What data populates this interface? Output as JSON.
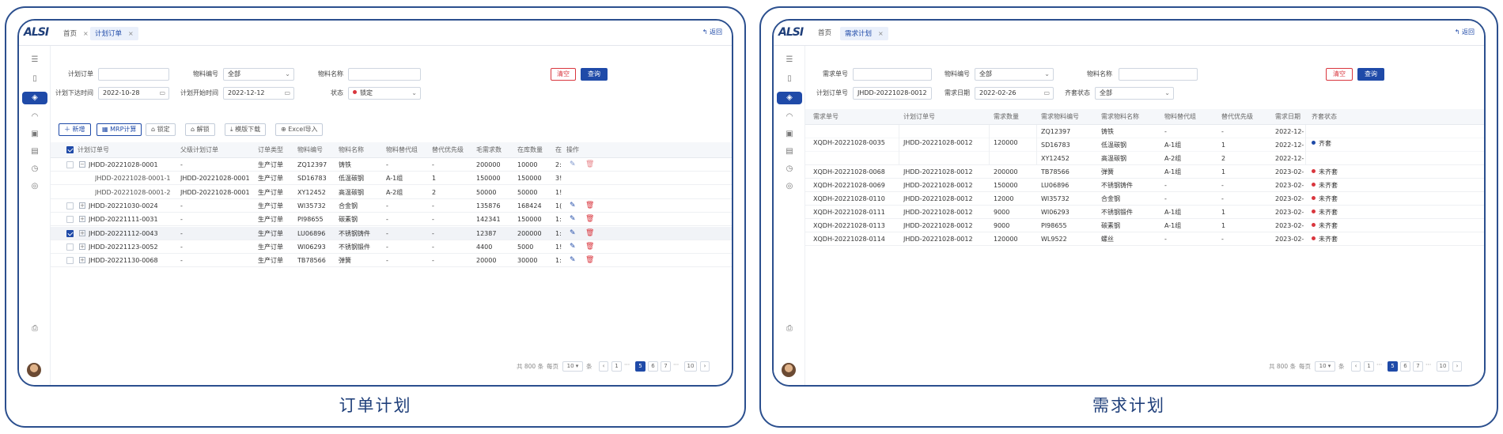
{
  "left": {
    "caption": "订单计划",
    "tabs": [
      {
        "label": "首页"
      },
      {
        "label": "计划订单"
      }
    ],
    "back_label": "返回",
    "filters": {
      "plan_order_label": "计划订单",
      "material_code_label": "物料编号",
      "material_code_value": "全部",
      "material_name_label": "物料名称",
      "issue_time_label": "计划下达时间",
      "issue_time_value": "2022-10-28",
      "start_time_label": "计划开始时间",
      "start_time_value": "2022-12-12",
      "status_label": "状态",
      "status_value": "锁定"
    },
    "clear_label": "清空",
    "query_label": "查询",
    "toolbar": [
      "新增",
      "MRP计算",
      "锁定",
      "解锁",
      "模版下载",
      "Excel导入"
    ],
    "columns": [
      "计划订单号",
      "父级计划订单",
      "订单类型",
      "物料编号",
      "物料名称",
      "物料替代组",
      "替代优先级",
      "毛需求数",
      "在库数量",
      "在",
      "操作"
    ],
    "rows": [
      {
        "no": "JHDD-20221028-0001",
        "parent": "-",
        "type": "生产订单",
        "code": "ZQ12397",
        "name": "铸铁",
        "group": "-",
        "prio": "-",
        "gross": "200000",
        "stock": "10000",
        "more": "2:"
      },
      {
        "no": "JHDD-20221028-0001-1",
        "parent": "JHDD-20221028-0001",
        "type": "生产订单",
        "code": "SD16783",
        "name": "低温碳钢",
        "group": "A-1组",
        "prio": "1",
        "gross": "150000",
        "stock": "150000",
        "more": "3!"
      },
      {
        "no": "JHDD-20221028-0001-2",
        "parent": "JHDD-20221028-0001",
        "type": "生产订单",
        "code": "XY12452",
        "name": "高温碳钢",
        "group": "A-2组",
        "prio": "2",
        "gross": "50000",
        "stock": "50000",
        "more": "1!"
      },
      {
        "no": "JHDD-20221030-0024",
        "parent": "-",
        "type": "生产订单",
        "code": "WI35732",
        "name": "合金钢",
        "group": "-",
        "prio": "-",
        "gross": "135876",
        "stock": "168424",
        "more": "1("
      },
      {
        "no": "JHDD-20221111-0031",
        "parent": "-",
        "type": "生产订单",
        "code": "PI98655",
        "name": "碳素钢",
        "group": "-",
        "prio": "-",
        "gross": "142341",
        "stock": "150000",
        "more": "1:"
      },
      {
        "no": "JHDD-20221112-0043",
        "parent": "-",
        "type": "生产订单",
        "code": "LU06896",
        "name": "不锈钢铸件",
        "group": "-",
        "prio": "-",
        "gross": "12387",
        "stock": "200000",
        "more": "1:"
      },
      {
        "no": "JHDD-20221123-0052",
        "parent": "-",
        "type": "生产订单",
        "code": "WI06293",
        "name": "不锈钢锻件",
        "group": "-",
        "prio": "-",
        "gross": "4400",
        "stock": "5000",
        "more": "1!"
      },
      {
        "no": "JHDD-20221130-0068",
        "parent": "-",
        "type": "生产订单",
        "code": "TB78566",
        "name": "弹簧",
        "group": "-",
        "prio": "-",
        "gross": "20000",
        "stock": "30000",
        "more": "1:"
      }
    ],
    "pager": {
      "total": "共 800 条",
      "per_page_label": "每页",
      "per_page": "10",
      "unit": "条",
      "pages": [
        "1",
        "5",
        "6",
        "7",
        "10"
      ],
      "current": "5"
    }
  },
  "right": {
    "caption": "需求计划",
    "tabs": [
      {
        "label": "首页"
      },
      {
        "label": "需求计划"
      }
    ],
    "back_label": "返回",
    "filters": {
      "demand_no_label": "需求单号",
      "material_code_label": "物料编号",
      "material_code_value": "全部",
      "material_name_label": "物料名称",
      "plan_order_label": "计划订单号",
      "plan_order_value": "JHDD-20221028-0012",
      "demand_date_label": "需求日期",
      "demand_date_value": "2022-02-26",
      "kit_status_label": "齐套状态",
      "kit_status_value": "全部"
    },
    "clear_label": "清空",
    "query_label": "查询",
    "columns": [
      "需求单号",
      "计划订单号",
      "需求数量",
      "需求物料编号",
      "需求物料名称",
      "物料替代组",
      "替代优先级",
      "需求日期",
      "齐套状态"
    ],
    "group": {
      "no": "XQDH-20221028-0035",
      "plan": "JHDD-20221028-0012",
      "qty": "120000",
      "status": "齐套",
      "items": [
        {
          "code": "ZQ12397",
          "name": "铸铁",
          "group": "-",
          "prio": "-",
          "date": "2022-12-"
        },
        {
          "code": "SD16783",
          "name": "低温碳钢",
          "group": "A-1组",
          "prio": "1",
          "date": "2022-12-"
        },
        {
          "code": "XY12452",
          "name": "高温碳钢",
          "group": "A-2组",
          "prio": "2",
          "date": "2022-12-"
        }
      ]
    },
    "rows": [
      {
        "no": "XQDH-20221028-0068",
        "plan": "JHDD-20221028-0012",
        "qty": "200000",
        "code": "TB78566",
        "name": "弹簧",
        "group": "A-1组",
        "prio": "1",
        "date": "2023-02-",
        "status": "未齐套"
      },
      {
        "no": "XQDH-20221028-0069",
        "plan": "JHDD-20221028-0012",
        "qty": "150000",
        "code": "LU06896",
        "name": "不锈钢铸件",
        "group": "-",
        "prio": "-",
        "date": "2023-02-",
        "status": "未齐套"
      },
      {
        "no": "XQDH-20221028-0110",
        "plan": "JHDD-20221028-0012",
        "qty": "12000",
        "code": "WI35732",
        "name": "合金钢",
        "group": "-",
        "prio": "-",
        "date": "2023-02-",
        "status": "未齐套"
      },
      {
        "no": "XQDH-20221028-0111",
        "plan": "JHDD-20221028-0012",
        "qty": "9000",
        "code": "WI06293",
        "name": "不锈钢锻件",
        "group": "A-1组",
        "prio": "1",
        "date": "2023-02-",
        "status": "未齐套"
      },
      {
        "no": "XQDH-20221028-0113",
        "plan": "JHDD-20221028-0012",
        "qty": "9000",
        "code": "PI98655",
        "name": "碳素钢",
        "group": "A-1组",
        "prio": "1",
        "date": "2023-02-",
        "status": "未齐套"
      },
      {
        "no": "XQDH-20221028-0114",
        "plan": "JHDD-20221028-0012",
        "qty": "120000",
        "code": "WL9522",
        "name": "螺丝",
        "group": "-",
        "prio": "-",
        "date": "2023-02-",
        "status": "未齐套"
      }
    ],
    "pager": {
      "total": "共 800 条",
      "per_page_label": "每页",
      "per_page": "10",
      "unit": "条",
      "pages": [
        "1",
        "5",
        "6",
        "7",
        "10"
      ],
      "current": "5"
    }
  },
  "colors": {
    "accent": "#1f4aa8",
    "danger": "#d9363e",
    "ok": "#1f4aa8",
    "frame": "#2b4f8e"
  },
  "icons": [
    "menu-icon",
    "document-icon",
    "shield-icon",
    "dashboard-icon",
    "calendar-icon",
    "clock-icon",
    "settings-icon",
    "print-icon"
  ]
}
